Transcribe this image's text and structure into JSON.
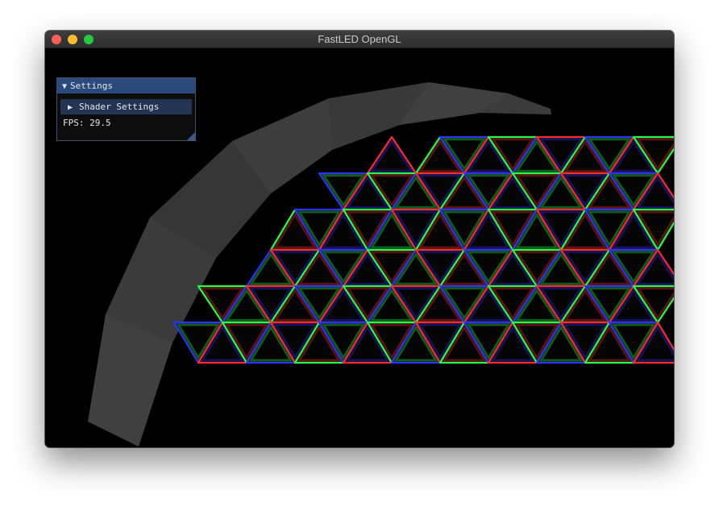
{
  "window": {
    "title": "FastLED OpenGL"
  },
  "settings_panel": {
    "title": "Settings",
    "title_arrow": "▼",
    "shader_settings_label": "Shader Settings",
    "shader_settings_arrow": "▶",
    "fps_label": "FPS:",
    "fps_value": "29.5"
  },
  "colors": {
    "close": "#fe5f57",
    "minimize": "#febc2e",
    "zoom": "#28c840",
    "panel_header": "#294a7a",
    "panel_button": "#223552",
    "dome_shell": "#3a3a3a",
    "led_red": "#ff2a2a",
    "led_green": "#22ff44",
    "led_blue": "#3030ff"
  }
}
